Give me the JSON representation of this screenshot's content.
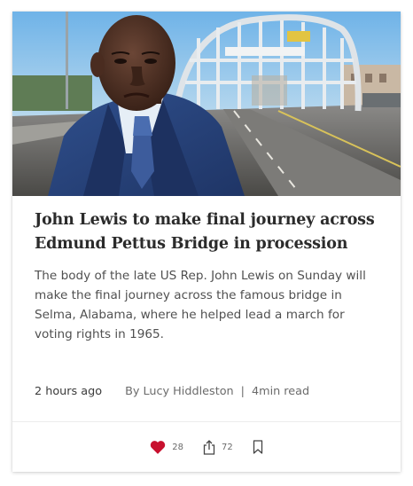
{
  "article": {
    "title": "John Lewis to make final journey across Edmund Pettus Bridge in procession",
    "summary": "The body of the late US Rep. John Lewis on Sunday will make the final journey across the famous bridge in Selma, Alabama, where he helped lead a march for voting rights in 1965.",
    "time_ago": "2 hours ago",
    "byline": "By Lucy Hiddleston",
    "separator": "|",
    "read_time": "4min read",
    "image_alt": "John Lewis standing in front of the Edmund Pettus Bridge"
  },
  "actions": {
    "likes": "28",
    "shares": "72",
    "like_icon": "heart-icon",
    "share_icon": "share-icon",
    "bookmark_icon": "bookmark-icon"
  },
  "colors": {
    "heart": "#c8102e",
    "title": "#2b2b2b",
    "body": "#505050"
  }
}
